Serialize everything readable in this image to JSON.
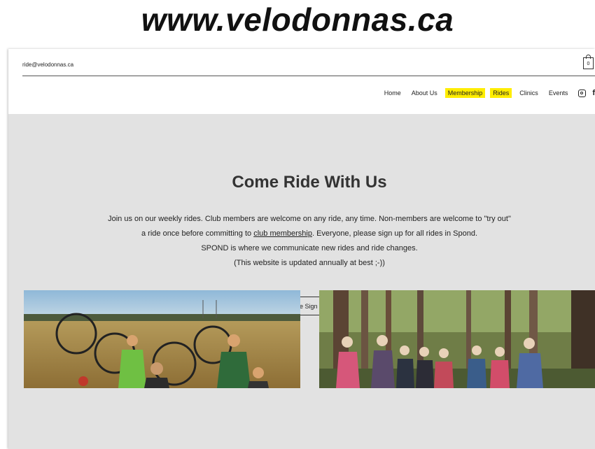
{
  "banner": {
    "url": "www.velodonnas.ca"
  },
  "header": {
    "email": "ride@velodonnas.ca",
    "cart_count": "0",
    "nav": [
      {
        "label": "Home",
        "highlighted": false
      },
      {
        "label": "About Us",
        "highlighted": false
      },
      {
        "label": "Membership",
        "highlighted": true
      },
      {
        "label": "Rides",
        "highlighted": true
      },
      {
        "label": "Clinics",
        "highlighted": false
      },
      {
        "label": "Events",
        "highlighted": false
      }
    ],
    "social_icons": [
      "instagram-icon",
      "facebook-icon"
    ],
    "highlight_color": "#ffed00"
  },
  "hero": {
    "title": "Come Ride With Us",
    "line1": "Join us on our weekly rides. Club members are welcome on any ride, any time. Non-members are welcome to \"try out\"",
    "line2_pre": "a ride once before committing to ",
    "line2_link": "club membership",
    "line2_post": ". Everyone, please sign up for all rides in Spond.",
    "line3": "SPOND is where we communicate new rides and ride changes.",
    "line4": "(This website is updated annually at best ;-))",
    "button_label": "Ride Sign Up",
    "background": "#e2e2e2"
  },
  "photos": [
    {
      "name": "cyclists-in-wheat-field-photo"
    },
    {
      "name": "cyclists-in-forest-photo"
    }
  ]
}
